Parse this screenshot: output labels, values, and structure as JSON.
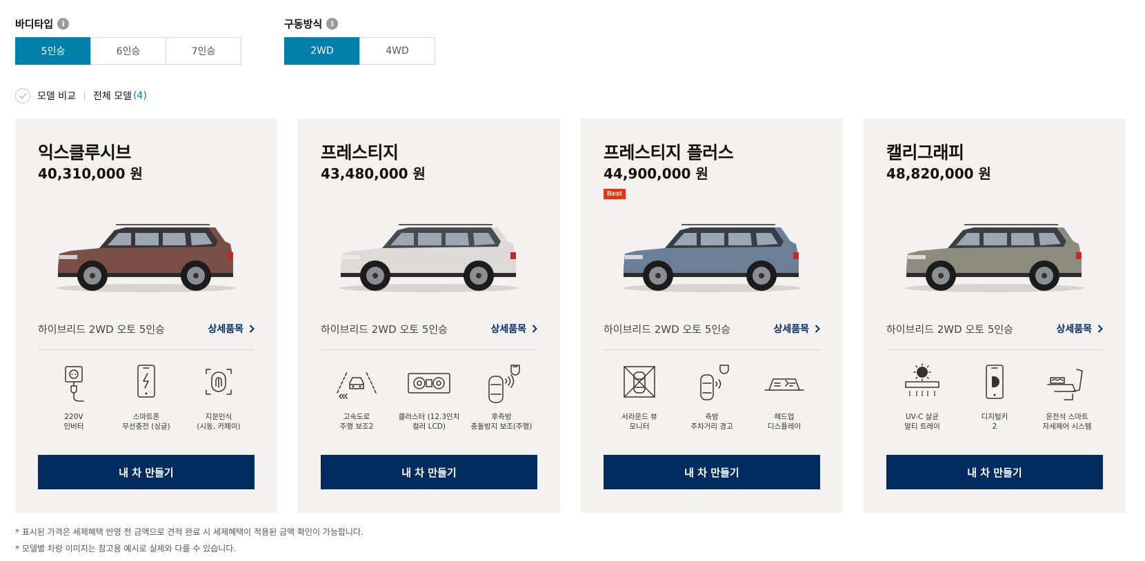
{
  "filters": {
    "body_type": {
      "title": "바디타입",
      "options": [
        "5인승",
        "6인승",
        "7인승"
      ],
      "selected": "5인승"
    },
    "drive": {
      "title": "구동방식",
      "options": [
        "2WD",
        "4WD"
      ],
      "selected": "2WD"
    }
  },
  "compare": {
    "label": "모델 비교",
    "total_label": "전체 모델",
    "total_count": "(4)"
  },
  "cards": [
    {
      "name": "익스클루시브",
      "price": "40,310,000 원",
      "badge": "",
      "car_color": "#7a5046",
      "trim": "하이브리드 2WD 오토 5인승",
      "detail": "상세품목",
      "features": [
        {
          "icon": "power-inverter-icon",
          "label": "220V\n인버터"
        },
        {
          "icon": "wireless-charger-icon",
          "label": "스마트폰\n무선충전 (싱글)"
        },
        {
          "icon": "fingerprint-icon",
          "label": "지문인식\n(시동, 카페이)"
        }
      ],
      "cta": "내 차 만들기"
    },
    {
      "name": "프레스티지",
      "price": "43,480,000 원",
      "badge": "",
      "car_color": "#dcdad6",
      "trim": "하이브리드 2WD 오토 5인승",
      "detail": "상세품목",
      "features": [
        {
          "icon": "highway-assist-icon",
          "label": "고속도로\n주행 보조2"
        },
        {
          "icon": "cluster-icon",
          "label": "클러스터 (12.3인치\n컬러 LCD)"
        },
        {
          "icon": "rear-collision-icon",
          "label": "후측방\n충돌방지 보조(주행)"
        }
      ],
      "cta": "내 차 만들기"
    },
    {
      "name": "프레스티지 플러스",
      "price": "44,900,000 원",
      "badge": "Best",
      "car_color": "#6b7f96",
      "trim": "하이브리드 2WD 오토 5인승",
      "detail": "상세품목",
      "features": [
        {
          "icon": "surround-view-icon",
          "label": "서라운드 뷰\n모니터"
        },
        {
          "icon": "parking-warning-icon",
          "label": "측방\n주차거리 경고"
        },
        {
          "icon": "head-up-display-icon",
          "label": "헤드업\n디스플레이"
        }
      ],
      "cta": "내 차 만들기"
    },
    {
      "name": "캘리그래피",
      "price": "48,820,000 원",
      "badge": "",
      "car_color": "#8c8c7e",
      "trim": "하이브리드 2WD 오토 5인승",
      "detail": "상세품목",
      "features": [
        {
          "icon": "uv-c-tray-icon",
          "label": "UV-C 살균\n멀티 트레이"
        },
        {
          "icon": "digital-key-icon",
          "label": "디지털키\n2"
        },
        {
          "icon": "smart-seat-icon",
          "label": "운전석 스마트\n자세제어 시스템"
        }
      ],
      "cta": "내 차 만들기"
    }
  ],
  "notes": [
    "* 표시된 가격은 세제혜택 반영 전 금액으로 견적 완료 시 세제혜택이 적용된 금액 확인이 가능합니다.",
    "* 모델별 차량 이미지는 참고용 예시로 실제와 다를 수 있습니다."
  ]
}
